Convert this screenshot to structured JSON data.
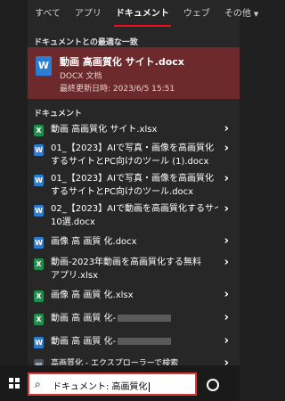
{
  "tabs": [
    {
      "label": "すべて"
    },
    {
      "label": "アプリ"
    },
    {
      "label": "ドキュメント"
    },
    {
      "label": "ウェブ"
    },
    {
      "label": "その他"
    }
  ],
  "best_match": {
    "section_title": "ドキュメントとの最適な一致",
    "name": "動画 高画質化 サイト.docx",
    "type": "DOCX 文档",
    "modified": "最終更新日時: 2023/6/5 15:51",
    "icon": "word-icon"
  },
  "documents": {
    "section_title": "ドキュメント",
    "items": [
      {
        "lines": [
          "動画 高画質化 サイト.xlsx"
        ],
        "icon": "excel-icon"
      },
      {
        "lines": [
          "01_【2023】AIで写真・画像を高画質化",
          "するサイトとPC向けのツール (1).docx"
        ],
        "icon": "word-icon"
      },
      {
        "lines": [
          "01_【2023】AIで写真・画像を高画質化",
          "するサイトとPC向けのツール.docx"
        ],
        "icon": "word-icon"
      },
      {
        "lines": [
          "02_【2023】AIで動画を高画質化するサイト",
          "10選.docx"
        ],
        "icon": "word-icon"
      },
      {
        "lines": [
          "画像 高 画質 化.docx"
        ],
        "icon": "word-icon"
      },
      {
        "lines": [
          "動画-2023年動画を高画質化する無料",
          "アプリ.xlsx"
        ],
        "icon": "excel-icon"
      },
      {
        "lines": [
          "画像 高 画質 化.xlsx"
        ],
        "icon": "excel-icon"
      },
      {
        "lines": [
          "動画 高 画質 化-"
        ],
        "icon": "excel-icon",
        "redacted": true
      },
      {
        "lines": [
          "動画 高 画質 化-"
        ],
        "icon": "word-icon",
        "redacted": true
      },
      {
        "lines": [
          "高画質化 - エクスプローラーで検索"
        ],
        "icon": "explorer-icon"
      }
    ]
  },
  "search": {
    "value": "ドキュメント: 高画質化"
  },
  "colors": {
    "accent": "#e81123",
    "best_bg": "#6d2a2d",
    "word": "#2b7cd3",
    "excel": "#1e8e4a"
  }
}
